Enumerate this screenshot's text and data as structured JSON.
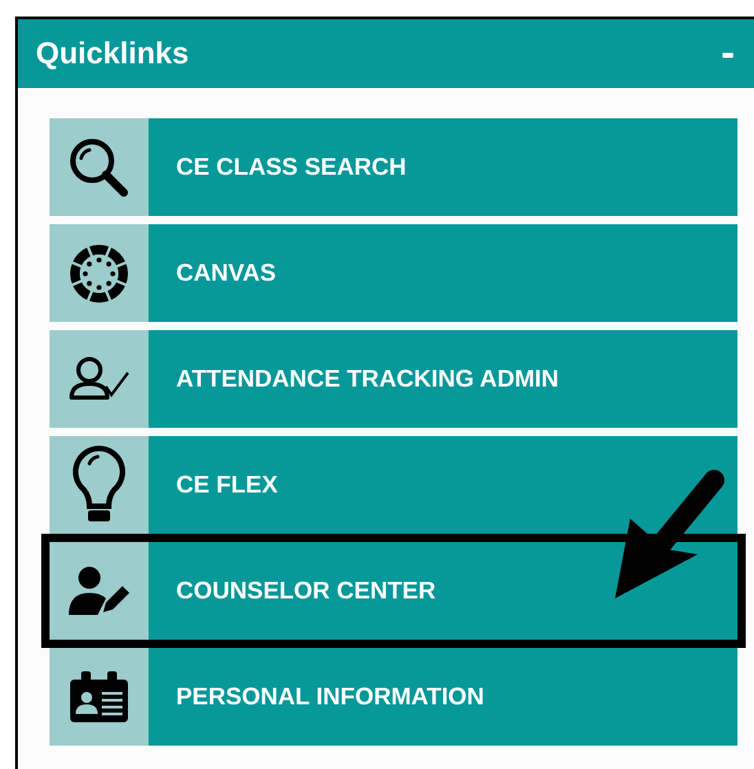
{
  "panel": {
    "title": "Quicklinks",
    "collapse_button": "-"
  },
  "links": [
    {
      "label": "CE CLASS SEARCH",
      "highlighted": false
    },
    {
      "label": "CANVAS",
      "highlighted": false
    },
    {
      "label": "ATTENDANCE TRACKING ADMIN",
      "highlighted": false
    },
    {
      "label": "CE FLEX",
      "highlighted": false
    },
    {
      "label": "COUNSELOR CENTER",
      "highlighted": true
    },
    {
      "label": "PERSONAL INFORMATION",
      "highlighted": false
    }
  ]
}
